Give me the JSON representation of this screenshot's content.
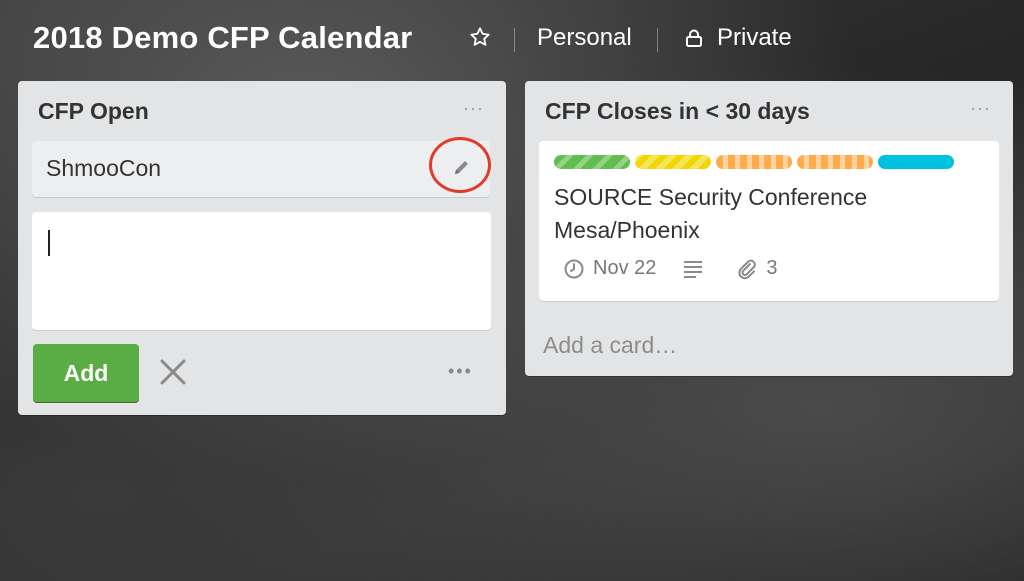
{
  "board": {
    "title": "2018 Demo CFP Calendar",
    "team": "Personal",
    "visibility": "Private"
  },
  "lists": {
    "open": {
      "title": "CFP Open",
      "card_name": "ShmooCon",
      "composer_value": "",
      "add_label": "Add"
    },
    "closes": {
      "title": "CFP Closes in < 30 days",
      "card_title": "SOURCE Security Conference Mesa/Phoenix",
      "due": "Nov 22",
      "attachments": "3",
      "add_card": "Add a card…"
    }
  },
  "labels": [
    {
      "color": "#61bd4f"
    },
    {
      "color": "#f2d600"
    },
    {
      "color": "#ffab4a"
    },
    {
      "color": "#ffab4a"
    },
    {
      "color": "#00c2e0"
    }
  ],
  "icons": {
    "star": "star-icon",
    "lock": "lock-icon",
    "edit": "pencil-icon",
    "close": "close-icon",
    "due": "clock-icon",
    "description": "description-icon",
    "attachment": "paperclip-icon"
  },
  "colors": {
    "add_button": "#5aac44",
    "highlight": "#e33a2a"
  }
}
